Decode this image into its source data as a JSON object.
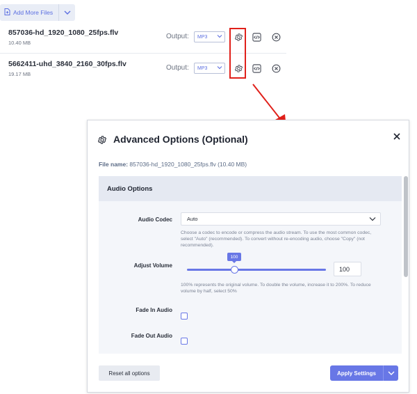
{
  "toolbar": {
    "add_more_label": "Add More Files"
  },
  "files": [
    {
      "name": "857036-hd_1920_1080_25fps.flv",
      "size": "10.40 MB",
      "output_label": "Output:",
      "output_value": "MP3"
    },
    {
      "name": "5662411-uhd_3840_2160_30fps.flv",
      "size": "19.17 MB",
      "output_label": "Output:",
      "output_value": "MP3"
    }
  ],
  "modal": {
    "title": "Advanced Options (Optional)",
    "file_label": "File name:",
    "file_value": "857036-hd_1920_1080_25fps.flv (10.40 MB)",
    "section_title": "Audio Options",
    "codec_label": "Audio Codec",
    "codec_value": "Auto",
    "codec_help": "Choose a codec to encode or compress the audio stream. To use the most common codec, select \"Auto\" (recommended). To convert without re-encoding audio, choose \"Copy\" (not recommended).",
    "volume_label": "Adjust Volume",
    "volume_value": "100",
    "volume_fraction": 0.34,
    "volume_help": "100% represents the original volume. To double the volume, increase it to 200%. To reduce volume by half, select 50%",
    "fade_in_label": "Fade In Audio",
    "fade_out_label": "Fade Out Audio",
    "reset_label": "Reset all options",
    "apply_label": "Apply Settings"
  },
  "colors": {
    "accent": "#6877e6",
    "highlight": "#e0201a",
    "link": "#5b6ee1"
  }
}
